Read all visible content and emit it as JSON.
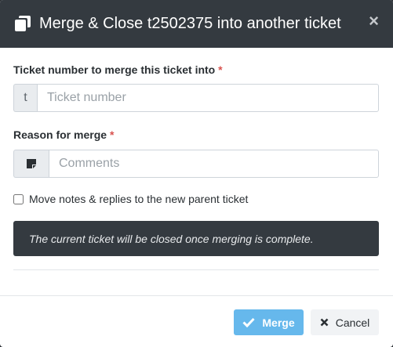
{
  "header": {
    "title": "Merge & Close t2502375 into another ticket"
  },
  "ticket_field": {
    "label": "Ticket number to merge this ticket into",
    "required_mark": "*",
    "prefix": "t",
    "placeholder": "Ticket number",
    "value": ""
  },
  "reason_field": {
    "label": "Reason for merge",
    "required_mark": "*",
    "placeholder": "Comments",
    "value": "",
    "icon": "sticky-note-icon"
  },
  "move_notes": {
    "label": "Move notes & replies to the new parent ticket",
    "checked": false
  },
  "notice": {
    "text": "The current ticket will be closed once merging is complete."
  },
  "footer": {
    "merge_label": "Merge",
    "cancel_label": "Cancel"
  },
  "colors": {
    "header_bg": "#343a40",
    "merge_button": "#66b8ec",
    "required": "#d9534f"
  }
}
